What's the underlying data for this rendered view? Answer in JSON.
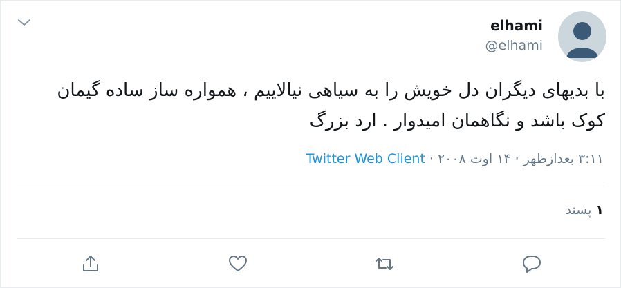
{
  "user": {
    "display_name": "elhami",
    "handle": "@elhami"
  },
  "tweet": {
    "text": "با بدیهای دیگران دل خویش را به سیاهی نیالاییم ، همواره ساز ساده گیمان کوک باشد و نگاهمان امیدوار . ارد بزرگ",
    "time": "۳:۱۱ بعدازظهر",
    "date": "۱۴ اوت ۲۰۰۸",
    "separator": "·",
    "source": "Twitter Web Client"
  },
  "likes": {
    "count": "۱",
    "label": "پسند"
  },
  "icons": {
    "menu": "chevron-down-icon",
    "reply": "comment-icon",
    "retweet": "retweet-icon",
    "like": "heart-icon",
    "share": "share-icon"
  },
  "colors": {
    "accent": "#1b95e0",
    "muted_text": "#657786",
    "primary_text": "#14171a",
    "divider": "#e6ecf0"
  }
}
